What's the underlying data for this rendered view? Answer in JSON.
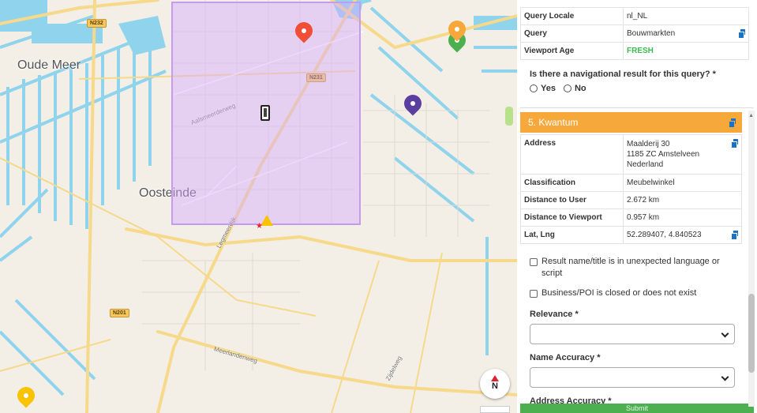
{
  "map": {
    "places": {
      "oude_meer": "Oude Meer",
      "oosteinde": "Oosteinde"
    },
    "shields": {
      "n232": "N232",
      "n231": "N231",
      "n201": "N201"
    },
    "streets": {
      "aalsmeerderweg": "Aalsmeerderweg",
      "legmeerdijk": "Legmeerdijk",
      "meerlandenweg": "Meerlandenweg",
      "zijdelweg": "Zijdelweg"
    },
    "compass_label": "N",
    "colors": {
      "viewport": "#d7aaff",
      "pin_red": "#f04e37",
      "pin_purple": "#5b3fa0",
      "pin_green": "#4caf50",
      "pin_orange": "#f6a83a",
      "pin_yellow": "#f9c300"
    }
  },
  "query_table": [
    {
      "key": "Query Locale",
      "value": "nl_NL",
      "copy": false
    },
    {
      "key": "Query",
      "value": "Bouwmarkten",
      "copy": true
    },
    {
      "key": "Viewport Age",
      "value": "FRESH",
      "copy": false
    }
  ],
  "nav_question": {
    "text": "Is there a navigational result for this query? *",
    "yes": "Yes",
    "no": "No"
  },
  "result": {
    "header": "5. Kwantum",
    "rows": [
      {
        "key": "Address",
        "lines": [
          "Maalderij 30",
          "1185 ZC Amstelveen",
          "Nederland"
        ],
        "copy": true
      },
      {
        "key": "Classification",
        "value": "Meubelwinkel",
        "copy": false
      },
      {
        "key": "Distance to User",
        "value": "2.672 km",
        "copy": false
      },
      {
        "key": "Distance to Viewport",
        "value": "0.957 km",
        "copy": false
      },
      {
        "key": "Lat, Lng",
        "value": "52.289407, 4.840523",
        "copy": true
      }
    ]
  },
  "checks": {
    "unexpected_language": "Result name/title is in unexpected language or script",
    "closed": "Business/POI is closed or does not exist"
  },
  "fields": {
    "relevance": "Relevance *",
    "name_accuracy": "Name Accuracy *",
    "address_accuracy": "Address Accuracy *"
  },
  "submit_label": "Submit"
}
